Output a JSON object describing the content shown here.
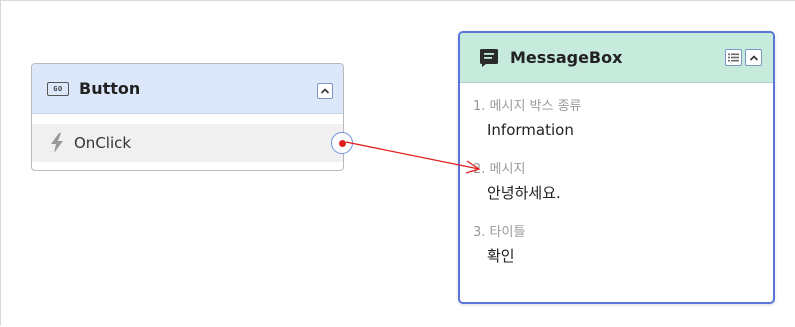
{
  "button_node": {
    "icon": "button-type-icon",
    "icon_text": "GO",
    "title": "Button",
    "event": "OnClick",
    "event_icon": "lightning-bolt-icon"
  },
  "messagebox_node": {
    "icon": "message-icon",
    "title": "MessageBox",
    "properties": [
      {
        "label": "1. 메시지 박스 종류",
        "value": "Information"
      },
      {
        "label": "2. 메시지",
        "value": "안녕하세요."
      },
      {
        "label": "3. 타이틀",
        "value": "확인"
      }
    ]
  },
  "colors": {
    "button_header": "#dce7fa",
    "messagebox_header": "#c6ebdc",
    "selected_border": "#5b75d8",
    "wire": "#e02020"
  }
}
